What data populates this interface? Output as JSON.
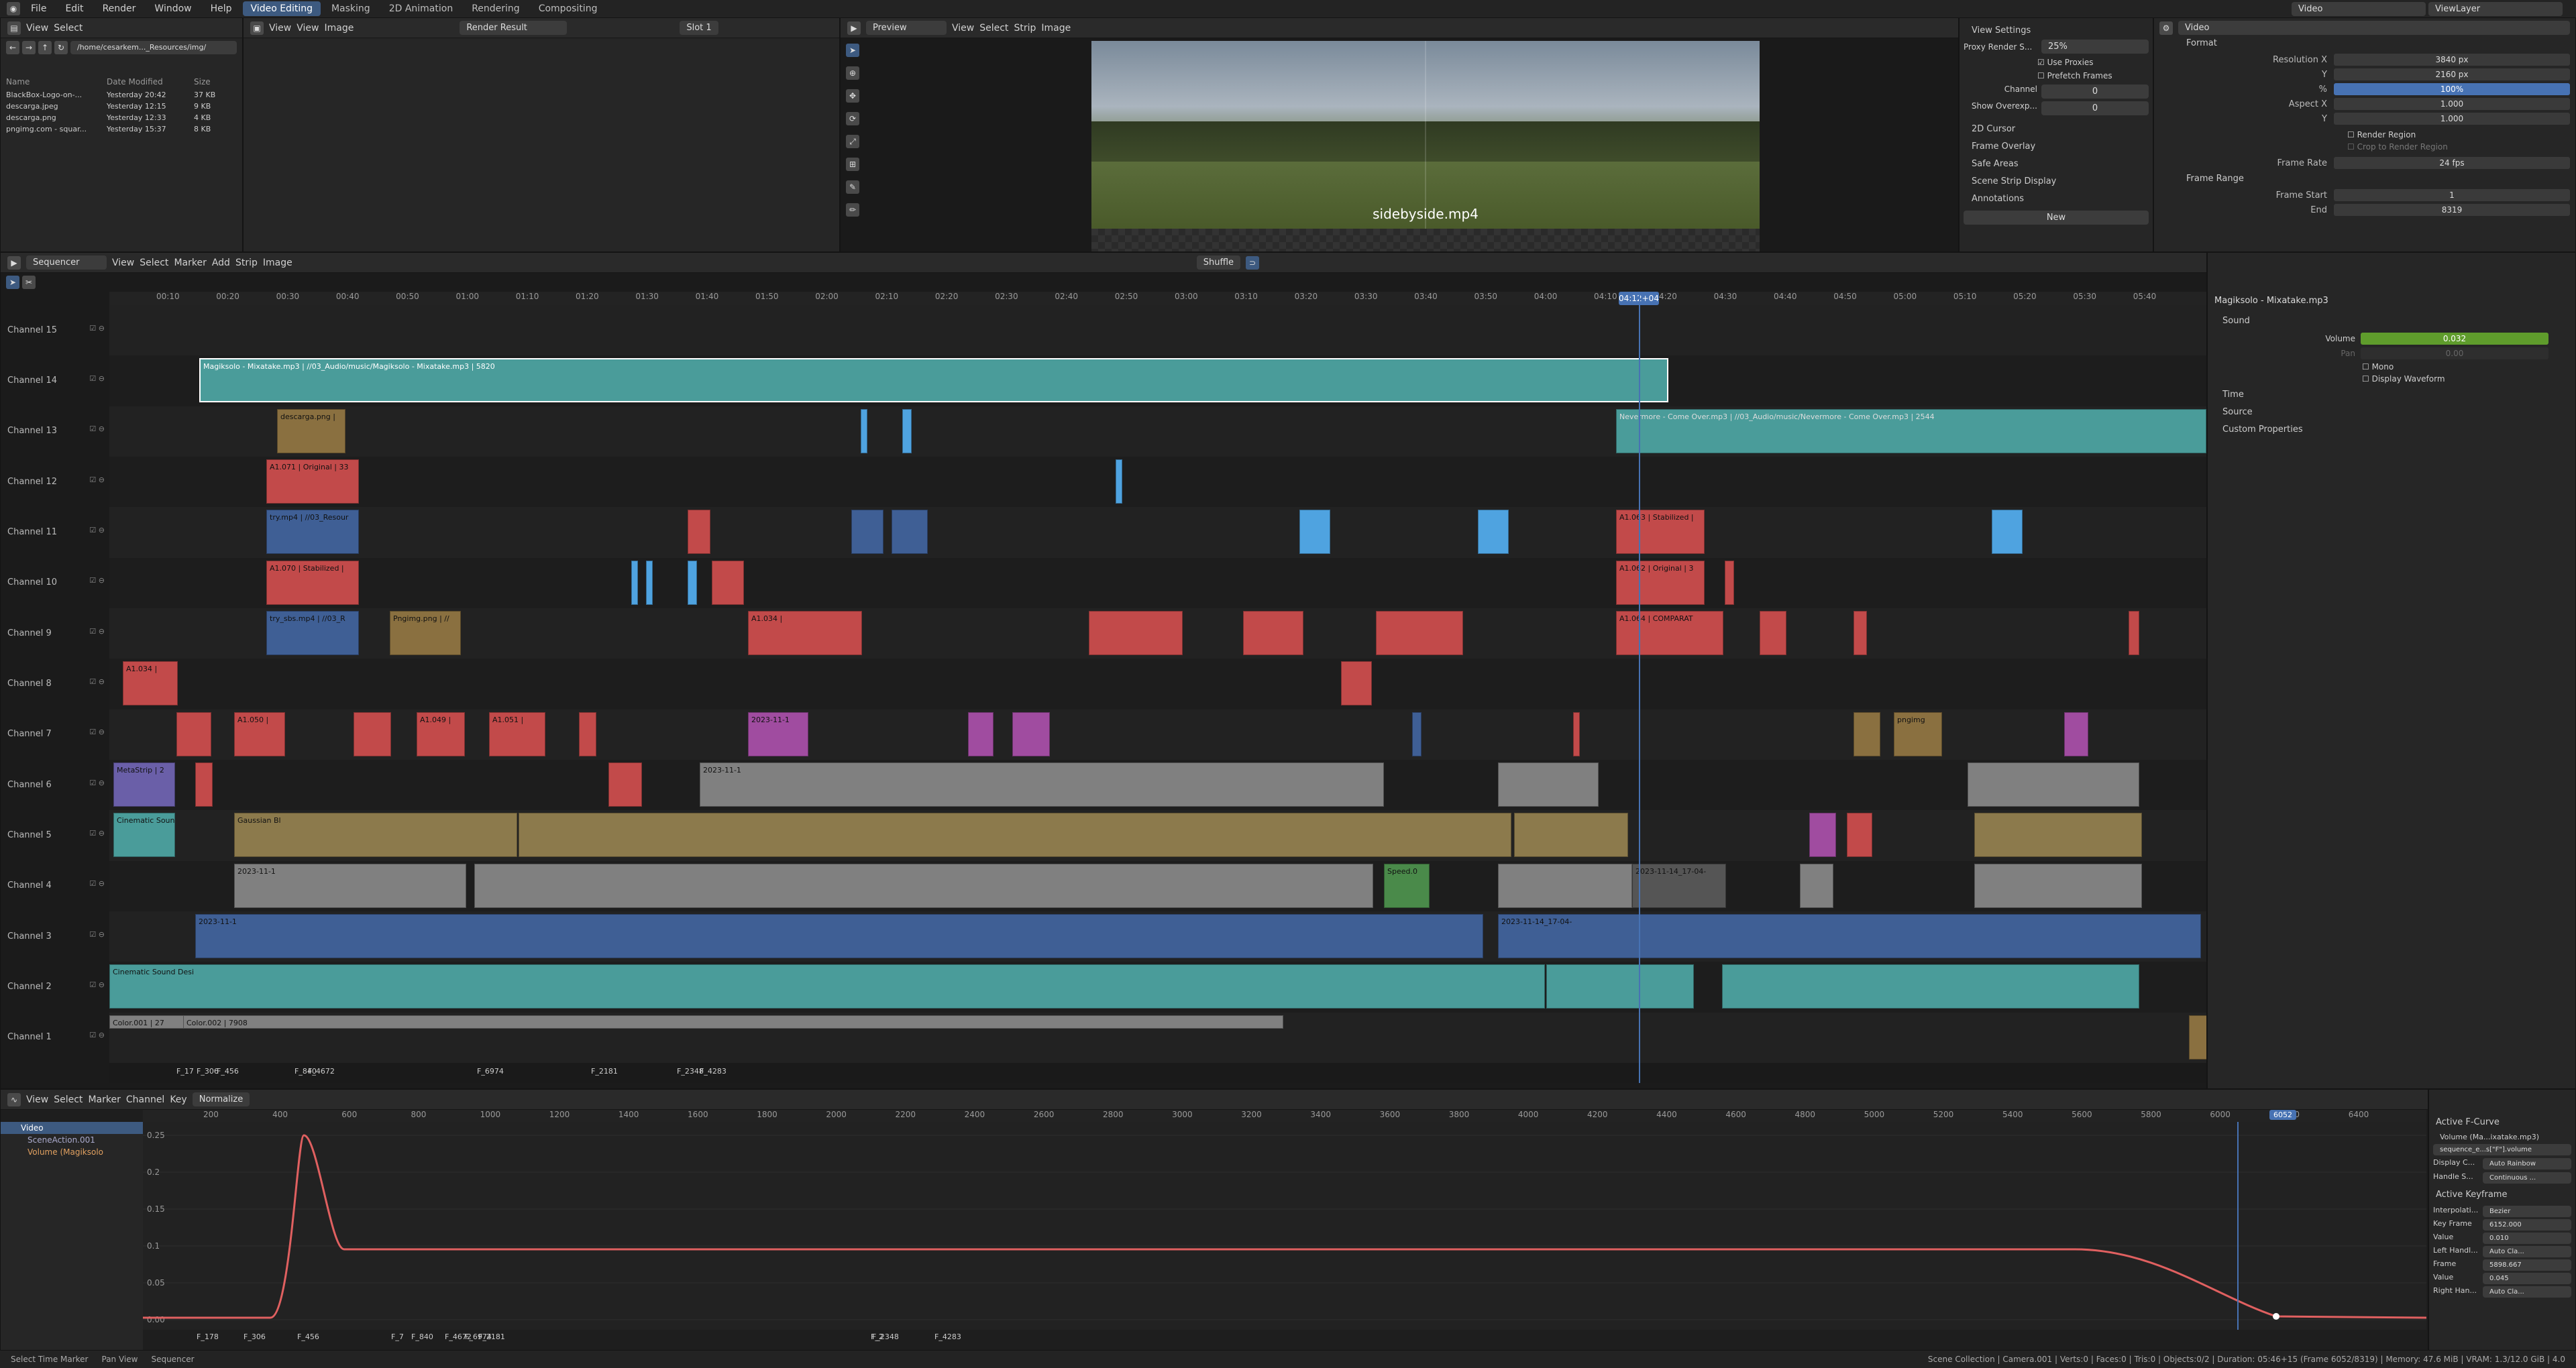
{
  "topbar": {
    "menus": [
      "File",
      "Edit",
      "Render",
      "Window",
      "Help"
    ],
    "workspaces": [
      "Video Editing",
      "Masking",
      "2D Animation",
      "Rendering",
      "Compositing"
    ],
    "active_workspace": "Video Editing",
    "scene": "Video",
    "view_layer": "ViewLayer"
  },
  "file_browser": {
    "menus": [
      "View",
      "Select"
    ],
    "path": "/home/cesarkem..._Resources/img/",
    "columns": [
      "Name",
      "Date Modified",
      "Size"
    ],
    "files": [
      {
        "name": "BlackBox-Logo-on-...",
        "date": "Yesterday 20:42",
        "size": "37 KB"
      },
      {
        "name": "descarga.jpeg",
        "date": "Yesterday 12:15",
        "size": "9 KB"
      },
      {
        "name": "descarga.png",
        "date": "Yesterday 12:33",
        "size": "4 KB"
      },
      {
        "name": "pngimg.com - squar...",
        "date": "Yesterday 15:37",
        "size": "8 KB"
      }
    ]
  },
  "image_editor": {
    "menus": [
      "View",
      "View",
      "Image"
    ],
    "image": "Render Result",
    "slot": "Slot 1"
  },
  "preview": {
    "mode": "Preview",
    "menus": [
      "View",
      "Select",
      "Strip",
      "Image"
    ],
    "caption": "sidebyside.mp4"
  },
  "view_settings": {
    "title": "View Settings",
    "proxy_render_size_label": "Proxy Render S...",
    "proxy_render_size": "25%",
    "use_proxies": "Use Proxies",
    "prefetch_frames": "Prefetch Frames",
    "channel_label": "Channel",
    "channel_value": "0",
    "show_overexp_label": "Show Overexp...",
    "show_overexp_value": "0",
    "sections": [
      "2D Cursor",
      "Frame Overlay",
      "Safe Areas",
      "Scene Strip Display",
      "Annotations"
    ],
    "new_button": "New"
  },
  "properties": {
    "search": "Video",
    "format_title": "Format",
    "rows": [
      {
        "label": "Resolution X",
        "value": "3840 px"
      },
      {
        "label": "Y",
        "value": "2160 px"
      },
      {
        "label": "%",
        "value": "100%"
      },
      {
        "label": "Aspect X",
        "value": "1.000"
      },
      {
        "label": "Y",
        "value": "1.000"
      }
    ],
    "render_region": "Render Region",
    "crop_render_region": "Crop to Render Region",
    "frame_rate_label": "Frame Rate",
    "frame_rate": "24 fps",
    "frame_range_title": "Frame Range",
    "frame_start_label": "Frame Start",
    "frame_start": "1",
    "end_label": "End",
    "end": "8319"
  },
  "sequencer": {
    "menus": [
      "Sequencer",
      "View",
      "Select",
      "Marker",
      "Add",
      "Strip",
      "Image"
    ],
    "snap": "Shuffle",
    "current_time": "04:12+04",
    "ruler": [
      "00:10",
      "00:20",
      "00:30",
      "00:40",
      "00:50",
      "01:00",
      "01:10",
      "01:20",
      "01:30",
      "01:40",
      "01:50",
      "02:00",
      "02:10",
      "02:20",
      "02:30",
      "02:40",
      "02:50",
      "03:00",
      "03:10",
      "03:20",
      "03:30",
      "03:40",
      "03:50",
      "04:00",
      "04:10",
      "04:20",
      "04:30",
      "04:40",
      "04:50",
      "05:00",
      "05:10",
      "05:20",
      "05:30",
      "05:40"
    ],
    "channels": [
      "Channel 15",
      "Channel 14",
      "Channel 13",
      "Channel 12",
      "Channel 11",
      "Channel 10",
      "Channel 9",
      "Channel 8",
      "Channel 7",
      "Channel 6",
      "Channel 5",
      "Channel 4",
      "Channel 3",
      "Channel 2",
      "Channel 1"
    ],
    "strip_labels": {
      "sound_main": "Magiksolo - Mixatake.mp3 | //03_Audio/music/Magiksolo - Mixatake.mp3 | 5820",
      "sound_nevermore": "Nevermore - Come Over.mp3 | //03_Audio/music/Nevermore - Come Over.mp3 | 2544",
      "descarga": "descarga.png |",
      "a1071": "A1.071 | Original | 33",
      "trymp4": "try.mp4 | //03_Resour",
      "a1070": "A1.070 | Stabilized |",
      "trysbs": "try_sbs.mp4 | //03_R",
      "pngimg": "Pngimg.png | //",
      "a1034": "A1.034 |",
      "a1050": "A1.050 |",
      "a1049": "A1.049 |",
      "a1051": "A1.051 |",
      "a1063": "A1.063 | Stabilized |",
      "a1062": "A1.062 | Original | 3",
      "a1064": "A1.064 | COMPARAT",
      "metastrip": "MetaStrip | 2",
      "speed": "Speed.0",
      "cinematic": "Cinematic Sound Desi",
      "color1": "Color.001 | 27",
      "color2": "Color.002 | 7908",
      "p2023": "2023-11-1",
      "p2023long": "2023-11-14_17-04-",
      "gaussian": "Gaussian Bl",
      "pngimg2": "pngimg"
    },
    "markers": [
      "F_17",
      "F_306",
      "F_456",
      "F_840",
      "F_4672",
      "F_6974",
      "F_2181",
      "F_2348",
      "F_4283"
    ]
  },
  "strip_props": {
    "strip_name": "Magiksolo - Mixatake.mp3",
    "sound_section": "Sound",
    "volume_label": "Volume",
    "volume": "0.032",
    "pan_label": "Pan",
    "pan": "0.00",
    "mono": "Mono",
    "display_waveform": "Display Waveform",
    "sections": [
      "Time",
      "Source",
      "Custom Properties"
    ]
  },
  "graph_editor": {
    "menus": [
      "View",
      "Select",
      "Marker",
      "Channel",
      "Key"
    ],
    "normalize": "Normalize",
    "channels": [
      "Video",
      "SceneAction.001",
      "Volume (Magiksolo"
    ],
    "ruler": [
      "200",
      "400",
      "600",
      "800",
      "1000",
      "1200",
      "1400",
      "1600",
      "1800",
      "2000",
      "2200",
      "2400",
      "2600",
      "2800",
      "3000",
      "3200",
      "3400",
      "3600",
      "3800",
      "4000",
      "4200",
      "4400",
      "4600",
      "4800",
      "5000",
      "5200",
      "5400",
      "5600",
      "5800",
      "6000",
      "6200",
      "6400"
    ],
    "current_frame": "6052",
    "yticks": [
      "0.25",
      "0.2",
      "0.15",
      "0.1",
      "0.05",
      "0.00"
    ],
    "markers": [
      "F_178",
      "F_306",
      "F_456",
      "F_7",
      "F_840",
      "F_4672",
      "F_6974",
      "F_2181",
      "F_2",
      "F_2348",
      "F_4283"
    ]
  },
  "fcurve_panel": {
    "active_fcurve": "Active F-Curve",
    "channel": "Volume (Ma...ixatake.mp3)",
    "path": "sequence_e...s[\"F\"].volume",
    "display_color_label": "Display C...",
    "display_color": "Auto Rainbow",
    "handle_smooth_label": "Handle S...",
    "handle_smooth": "Continuous ...",
    "active_keyframe": "Active Keyframe",
    "interp_label": "Interpolati...",
    "interp": "Bezier",
    "keyframe_label": "Key Frame",
    "keyframe": "6152.000",
    "value_label": "Value",
    "value": "0.010",
    "left_handle_label": "Left Handl...",
    "left_handle": "Auto Cla...",
    "frame_label": "Frame",
    "frame": "5898.667",
    "lvalue": "0.045",
    "right_handle_label": "Right Han...",
    "right_handle": "Auto Cla..."
  },
  "status": {
    "left1": "Select Time Marker",
    "left2": "Pan View",
    "left3": "Sequencer",
    "right": "Scene Collection | Camera.001 | Verts:0 | Faces:0 | Tris:0 | Objects:0/2 | Duration: 05:46+15 (Frame 6052/8319) | Memory: 47.6 MiB | VRAM: 1.3/12.0 GiB | 4.0"
  },
  "colors": {
    "accent": "#3d5a80",
    "sound": "#4a9c9a",
    "image": "#8a7040",
    "movie": "#c24a4a",
    "meta": "#6a5fa8",
    "effect": "#a04ca0",
    "video_blue": "#3f5f95",
    "color_strip": "#808080",
    "gaussian": "#8c7a4c",
    "curve": "#e06060"
  }
}
